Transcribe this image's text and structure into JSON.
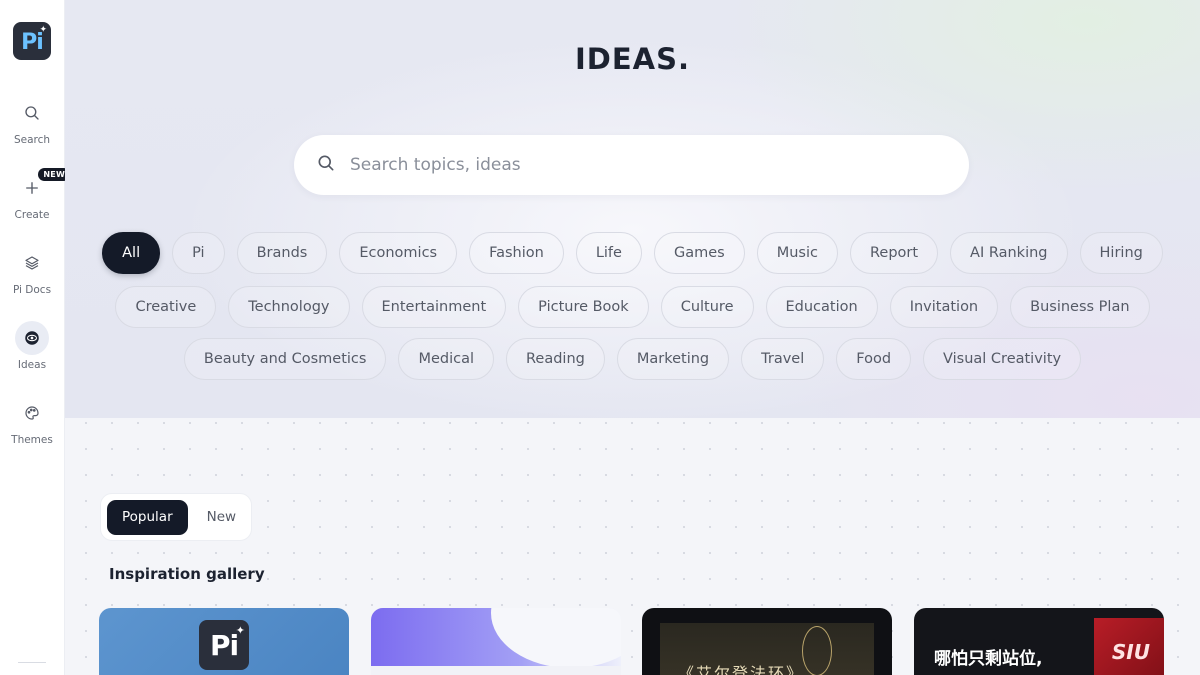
{
  "sidebar": {
    "logo_text": "Pi",
    "items": [
      {
        "label": "Search",
        "icon": "search-icon"
      },
      {
        "label": "Create",
        "icon": "plus-icon",
        "badge": "NEW"
      },
      {
        "label": "Pi Docs",
        "icon": "layers-icon"
      },
      {
        "label": "Ideas",
        "icon": "ideas-icon",
        "active": true
      },
      {
        "label": "Themes",
        "icon": "palette-icon"
      }
    ]
  },
  "hero": {
    "title": "IDEAS.",
    "search_placeholder": "Search topics, ideas"
  },
  "categories": {
    "row1": [
      "All",
      "Pi",
      "Brands",
      "Economics",
      "Fashion",
      "Life",
      "Games",
      "Music",
      "Report",
      "AI Ranking",
      "Hiring"
    ],
    "row2": [
      "Creative",
      "Technology",
      "Entertainment",
      "Picture Book",
      "Culture",
      "Education",
      "Invitation",
      "Business Plan"
    ],
    "row3": [
      "Beauty and Cosmetics",
      "Medical",
      "Reading",
      "Marketing",
      "Travel",
      "Food",
      "Visual Creativity"
    ],
    "selected": "All"
  },
  "gallery": {
    "tabs": [
      "Popular",
      "New"
    ],
    "selected_tab": "Popular",
    "title": "Inspiration gallery",
    "cards": [
      {
        "text": "Pi"
      },
      {
        "text": ""
      },
      {
        "text": "《艾尔登法环》"
      },
      {
        "text": "哪怕只剩站位,",
        "overlay": "SIU"
      }
    ]
  },
  "colors": {
    "accent_dark": "#141a28",
    "logo_blue": "#6cc2ff"
  }
}
